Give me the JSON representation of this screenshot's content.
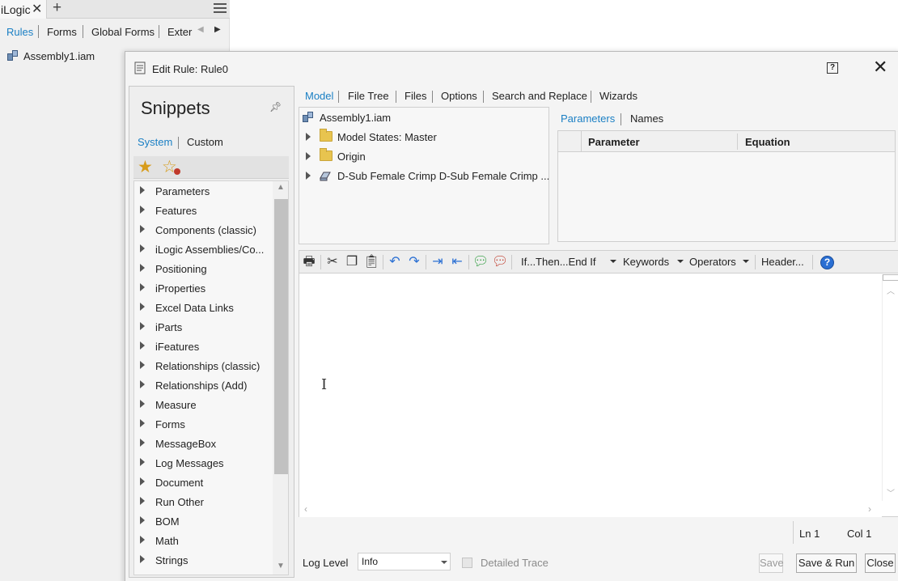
{
  "background": {
    "tab_label": "iLogic",
    "nav": [
      "Rules",
      "Forms",
      "Global Forms",
      "Exter"
    ],
    "active_nav": "Rules",
    "tree_item": "Assembly1.iam"
  },
  "dialog": {
    "title": "Edit Rule: Rule0",
    "help_glyph": "?",
    "close_glyph": "✕"
  },
  "snippets": {
    "title": "Snippets",
    "tabs": [
      "System",
      "Custom"
    ],
    "active_tab": "System",
    "items": [
      "Parameters",
      "Features",
      "Components (classic)",
      "iLogic Assemblies/Co...",
      "Positioning",
      "iProperties",
      "Excel Data Links",
      "iParts",
      "iFeatures",
      "Relationships (classic)",
      "Relationships (Add)",
      "Measure",
      "Forms",
      "MessageBox",
      "Log Messages",
      "Document",
      "Run Other",
      "BOM",
      "Math",
      "Strings"
    ]
  },
  "model_tabs": [
    "Model",
    "File Tree",
    "Files",
    "Options",
    "Search and Replace",
    "Wizards"
  ],
  "active_model_tab": "Model",
  "model_tree": {
    "root": "Assembly1.iam",
    "children": [
      "Model States: Master",
      "Origin",
      "D-Sub Female Crimp D-Sub Female Crimp ..."
    ]
  },
  "params": {
    "tabs": [
      "Parameters",
      "Names"
    ],
    "active_tab": "Parameters",
    "columns": [
      "Parameter",
      "Equation"
    ]
  },
  "toolbar": {
    "if_then": "If...Then...End If",
    "keywords": "Keywords",
    "operators": "Operators",
    "header": "Header..."
  },
  "status": {
    "line": "Ln 1",
    "col": "Col 1"
  },
  "bottom": {
    "log_level_label": "Log Level",
    "log_level_value": "Info",
    "detailed_trace": "Detailed Trace",
    "save": "Save",
    "save_run": "Save & Run",
    "close": "Close"
  },
  "colors": {
    "accent_blue": "#1a7fc4",
    "star": "#d79c1b"
  }
}
